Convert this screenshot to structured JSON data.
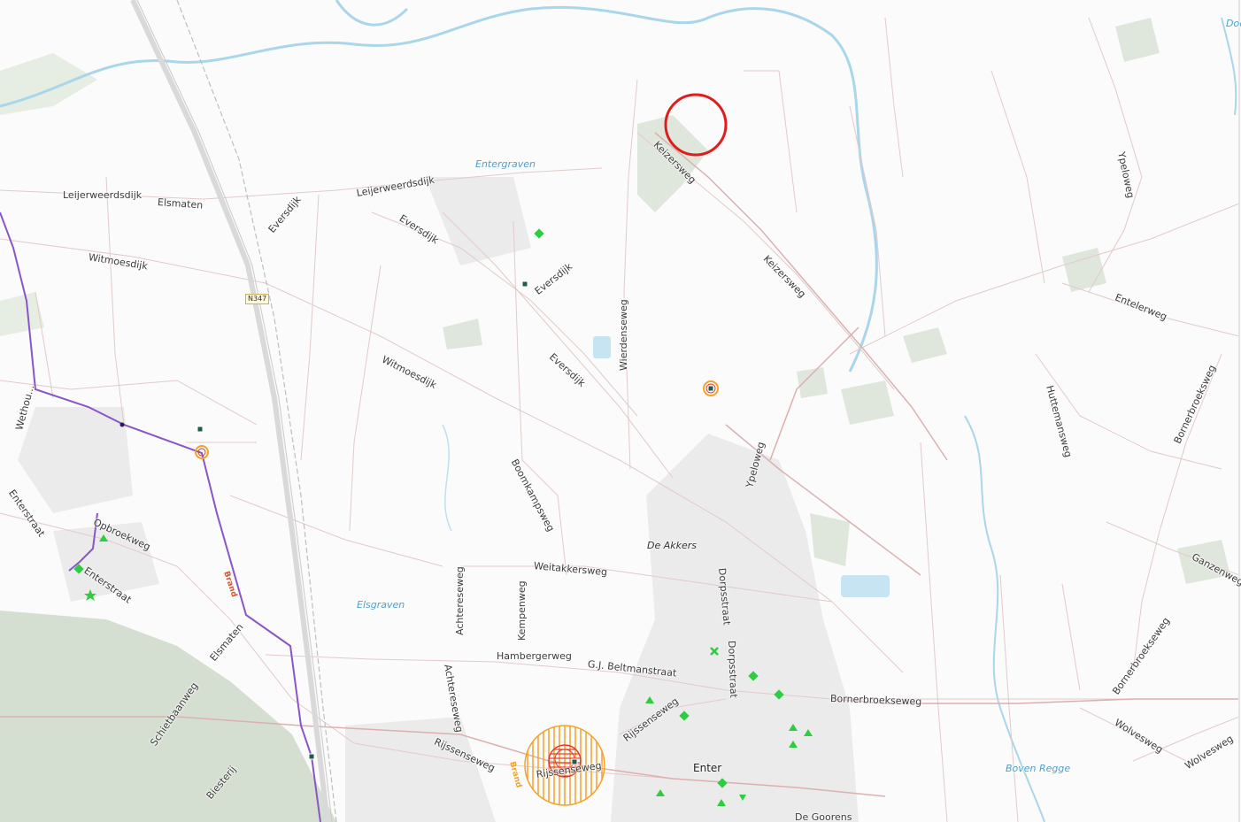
{
  "map": {
    "roads": {
      "leijerweerdsdijk_w": "Leijerweerdsdijk",
      "elsmaten_n": "Elsmaten",
      "leijerweerdsdijk_e": "Leijerweerdsdijk",
      "eversdijk_1": "Eversdijk",
      "eversdijk_2": "Eversdijk",
      "eversdijk_3": "Eversdijk",
      "eversdijk_4": "Eversdijk",
      "witmoesdijk_1": "Witmoesdijk",
      "witmoesdijk_2": "Witmoesdijk",
      "keizersweg_1": "Keizersweg",
      "keizersweg_2": "Keizersweg",
      "wierdenseweg": "Wierdenseweg",
      "ypeloweg_n": "Ypeloweg",
      "ypeloweg_s": "Ypeloweg",
      "entelerweg": "Entelerweg",
      "huttemansweg": "Huttemansweg",
      "bornerbroeksweg_n": "Bornerbroeksweg",
      "bornerbroeksweg_s": "Bornerbroekseweg",
      "bornerbroekseweg": "Bornerbroekseweg",
      "ganzenweg": "Ganzenweg",
      "wolvesweg_1": "Wolvesweg",
      "wolvesweg_2": "Wolvesweg",
      "boomkampsweg": "Boomkampsweg",
      "weitakkersweg": "Weitakkersweg",
      "dorpsstraat_1": "Dorpsstraat",
      "dorpsstraat_2": "Dorpsstraat",
      "achtereseweg_1": "Achtereseweg",
      "achtereseweg_2": "Achtereseweg",
      "kempenweg": "Kempenweg",
      "hambergerweg": "Hambergerweg",
      "gj_beltmanstraat": "G.J. Beltmanstraat",
      "rijssenseweg_1": "Rijssenseweg",
      "rijssenseweg_2": "Rijssenseweg",
      "rijssenseweg_3": "Rijssenseweg",
      "enterstraat_1": "Enterstraat",
      "enterstraat_2": "Enterstraat",
      "opbroekweg": "Opbroekweg",
      "elsmaten_s": "Elsmaten",
      "schietbaanweg": "Schietbaanweg",
      "biesterij": "Biesterij",
      "wethouder": "Wethou...",
      "de_goorens": "De Goorens",
      "n347": "N347"
    },
    "water": {
      "entergraven": "Entergraven",
      "elsgraven": "Elsgraven",
      "boven_regge": "Boven Regge",
      "doo": "Doo"
    },
    "places": {
      "de_akkers": "De Akkers",
      "enter": "Enter"
    },
    "pipeline_labels": {
      "brand": "Brand",
      "brand2": "Brand"
    },
    "colors": {
      "background": "#fbfbfb",
      "road": "#d9b8b8",
      "river": "#a9d6ea",
      "forest": "#cfdccb",
      "pipeline": "#8a55c9",
      "risk_orange": "#f2a32a",
      "risk_red": "#e23a2a",
      "highlight_circle": "#e01c1c",
      "green_marker": "#2ecc40"
    }
  }
}
